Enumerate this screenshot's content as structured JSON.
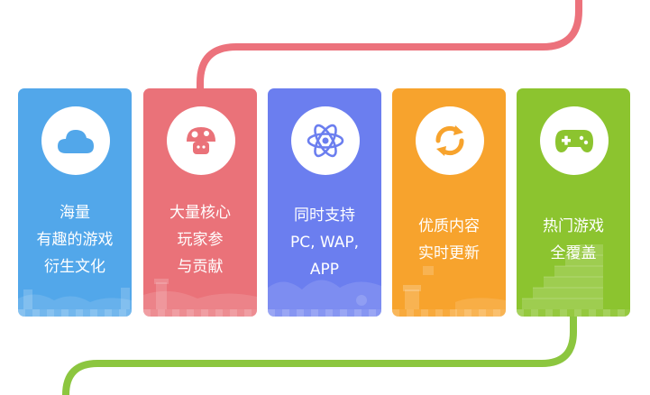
{
  "colors": {
    "blue": "#52a7ea",
    "red": "#ea7279",
    "indigo": "#6b7eef",
    "orange": "#f7a32d",
    "green": "#8cc42f",
    "line_red": "#ec727c",
    "line_green": "#8cc63f"
  },
  "cards": [
    {
      "icon": "cloud-icon",
      "lines": [
        "海量",
        "有趣的游戏",
        "衍生文化"
      ]
    },
    {
      "icon": "mushroom-icon",
      "lines": [
        "大量核心",
        "玩家参",
        "与贡献"
      ]
    },
    {
      "icon": "atom-icon",
      "lines": [
        "同时支持",
        "PC, WAP,",
        "APP"
      ]
    },
    {
      "icon": "sync-icon",
      "lines": [
        "优质内容",
        "实时更新"
      ]
    },
    {
      "icon": "gamepad-icon",
      "lines": [
        "热门游戏",
        "全覆盖"
      ]
    }
  ]
}
